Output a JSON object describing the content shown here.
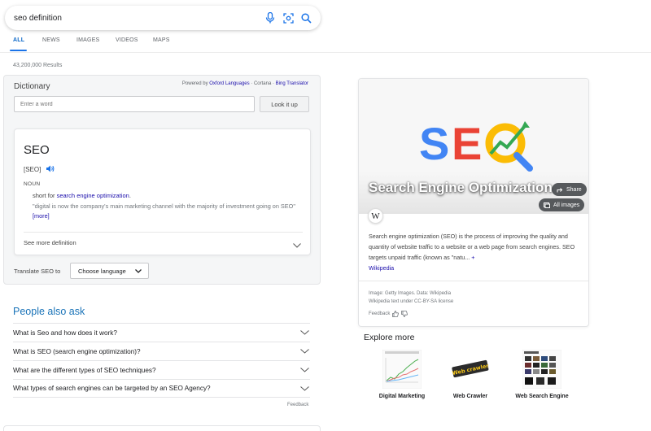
{
  "search": {
    "query": "seo definition"
  },
  "tabs": [
    {
      "label": "ALL",
      "active": true
    },
    {
      "label": "NEWS",
      "active": false
    },
    {
      "label": "IMAGES",
      "active": false
    },
    {
      "label": "VIDEOS",
      "active": false
    },
    {
      "label": "MAPS",
      "active": false
    }
  ],
  "results_count": "43,200,000 Results",
  "dictionary": {
    "title": "Dictionary",
    "powered_prefix": "Powered by ",
    "powered_oxford": "Oxford Languages",
    "powered_middle": " · Cortana · ",
    "powered_bing": "Bing Translator",
    "input_placeholder": "Enter a word",
    "lookup_label": "Look it up",
    "word": "SEO",
    "phonetic": "[SEO]",
    "pos": "NOUN",
    "short_for_prefix": "short for ",
    "short_for_link": "search engine optimization",
    "short_for_suffix": ".",
    "example": "\"digital is now the company's main marketing channel with the majority of investment going on SEO\"",
    "example_more": "[more]",
    "see_more": "See more definition",
    "translate_label": "Translate SEO to",
    "language_select": "Choose language"
  },
  "people_also_ask": {
    "title": "People also ask",
    "questions": [
      "What is Seo and how does it work?",
      "What is SEO (search engine optimization)?",
      "What are the different types of SEO techniques?",
      "What types of search engines can be targeted by an SEO Agency?"
    ],
    "feedback": "Feedback"
  },
  "knowledge_panel": {
    "logo_text": "SEO",
    "title": "Search Engine Optimization",
    "share_label": "Share",
    "all_images_label": "All images",
    "wiki_glyph": "W",
    "description": "Search engine optimization (SEO) is the process of improving the quality and quantity of website traffic to a website or a web page from search engines. SEO targets unpaid traffic (known as \"natu...",
    "description_more": "+",
    "source_link": "Wikipedia",
    "credit_image": "Image: Getty Images. Data: Wikipedia",
    "credit_text": "Wikipedia text under CC-BY-SA license",
    "feedback": "Feedback"
  },
  "explore_more": {
    "title": "Explore more",
    "items": [
      {
        "label": "Digital Marketing"
      },
      {
        "label": "Web Crawler",
        "thumb_text": "Web crawler"
      },
      {
        "label": "Web Search Engine"
      }
    ]
  },
  "colors": {
    "accent_blue": "#1a73e8",
    "link": "#1a0dab",
    "seo_s": "#4285f4",
    "seo_e": "#ea4335",
    "seo_o": "#fbbc05",
    "seo_arrow": "#34a853"
  }
}
